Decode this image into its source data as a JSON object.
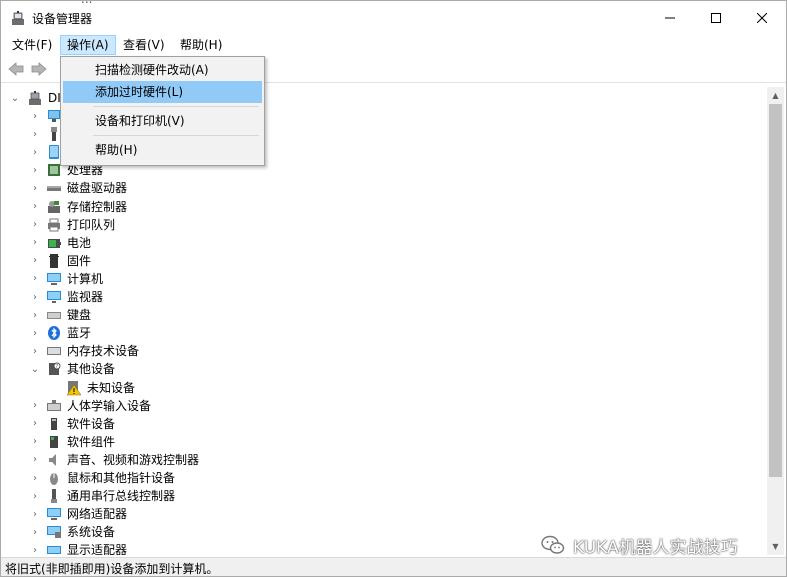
{
  "window": {
    "title": "设备管理器",
    "cropped_title": "...",
    "buttons": {
      "minimize": "minimize",
      "maximize": "maximize",
      "close": "close"
    }
  },
  "menubar": [
    {
      "label": "文件(F)"
    },
    {
      "label": "操作(A)",
      "active": true
    },
    {
      "label": "查看(V)"
    },
    {
      "label": "帮助(H)"
    }
  ],
  "dropdown": {
    "items": [
      {
        "label": "扫描检测硬件改动(A)"
      },
      {
        "label": "添加过时硬件(L)",
        "highlighted": true
      },
      {
        "label": "设备和打印机(V)"
      },
      {
        "label": "帮助(H)"
      }
    ]
  },
  "tree": {
    "root_label": "DI",
    "items": [
      {
        "label": "",
        "icon": "network-icon"
      },
      {
        "label": "",
        "icon": "usb-icon"
      },
      {
        "label": "",
        "icon": "tablet-icon"
      },
      {
        "label": "处理器",
        "icon": "processor-icon"
      },
      {
        "label": "磁盘驱动器",
        "icon": "disk-icon"
      },
      {
        "label": "存储控制器",
        "icon": "storage-controller-icon"
      },
      {
        "label": "打印队列",
        "icon": "printer-icon"
      },
      {
        "label": "电池",
        "icon": "battery-icon"
      },
      {
        "label": "固件",
        "icon": "firmware-icon"
      },
      {
        "label": "计算机",
        "icon": "computer-icon"
      },
      {
        "label": "监视器",
        "icon": "monitor-icon"
      },
      {
        "label": "键盘",
        "icon": "keyboard-icon"
      },
      {
        "label": "蓝牙",
        "icon": "bluetooth-icon"
      },
      {
        "label": "内存技术设备",
        "icon": "memory-icon"
      },
      {
        "label": "其他设备",
        "icon": "other-devices-icon",
        "expanded": true
      },
      {
        "label": "未知设备",
        "icon": "unknown-device-warning-icon",
        "child": true
      },
      {
        "label": "人体学输入设备",
        "icon": "hid-icon"
      },
      {
        "label": "软件设备",
        "icon": "software-device-icon"
      },
      {
        "label": "软件组件",
        "icon": "software-component-icon"
      },
      {
        "label": "声音、视频和游戏控制器",
        "icon": "audio-icon"
      },
      {
        "label": "鼠标和其他指针设备",
        "icon": "mouse-icon"
      },
      {
        "label": "通用串行总线控制器",
        "icon": "usb-controller-icon"
      },
      {
        "label": "网络适配器",
        "icon": "network-adapter-icon"
      },
      {
        "label": "系统设备",
        "icon": "system-device-icon"
      },
      {
        "label": "显示适配器",
        "icon": "display-adapter-icon"
      }
    ]
  },
  "statusbar": {
    "text": "将旧式(非即插即用)设备添加到计算机。"
  },
  "watermark": {
    "text": "KUKA机器人实战技巧",
    "icon": "wechat-icon"
  },
  "colors": {
    "menu_active_bg": "#cce8ff",
    "dropdown_highlight": "#91c9f7",
    "scroll_thumb": "#c2c2c2"
  }
}
